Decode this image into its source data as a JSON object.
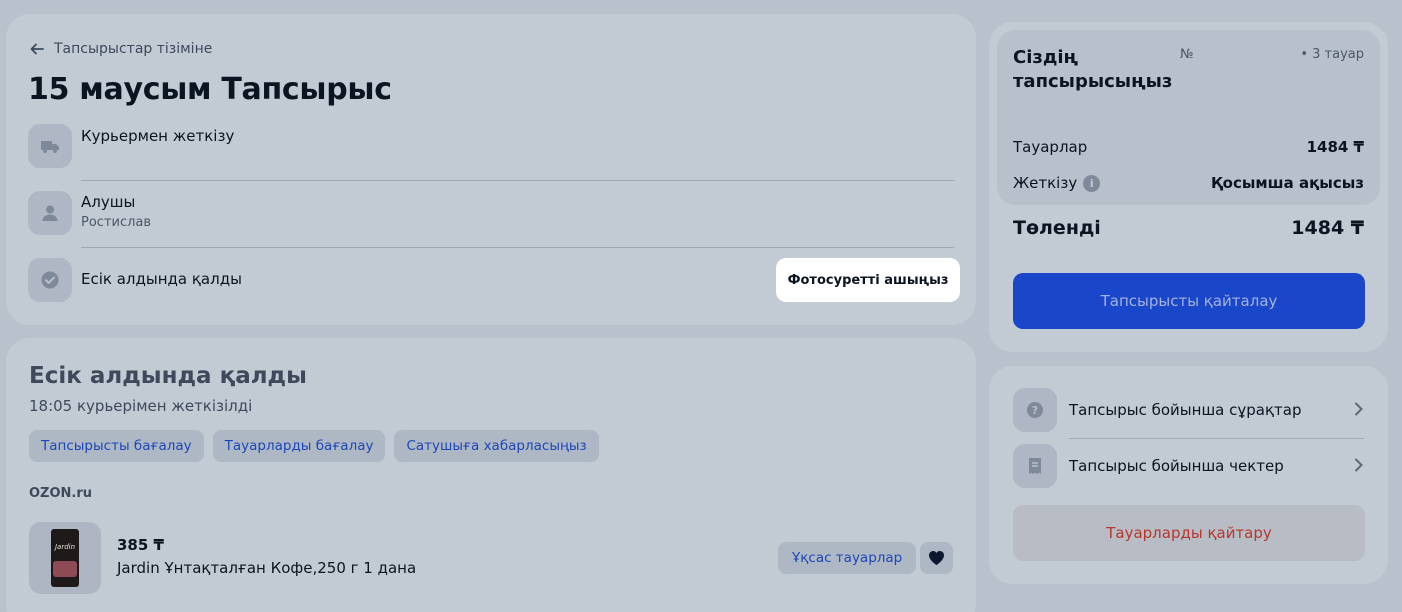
{
  "order": {
    "back_label": "Тапсырыстар тізіміне",
    "title": "15 маусым Тапсырыс",
    "delivery_method": "Курьермен жеткізу",
    "recipient_label": "Алушы",
    "recipient_name": "Ростислав",
    "status": "Есік алдында қалды",
    "photo_button": "Фотосуретті ашыңыз"
  },
  "delivery": {
    "title": "Есік алдында қалды",
    "subtitle": "18:05 курьерімен жеткізілді",
    "actions": [
      "Тапсырысты бағалау",
      "Тауарларды бағалау",
      "Сатушыға хабарласыңыз"
    ],
    "seller": "OZON.ru",
    "product": {
      "price": "385 ₸",
      "name": "Jardin Ұнтақталған Кофе,250 г 1 дана",
      "image_brand": "Jardin",
      "similar_button": "Ұқсас тауарлар",
      "fav_icon": "heart-icon"
    }
  },
  "summary": {
    "title": "Сіздің тапсырысыңыз",
    "number_label": "№",
    "count": "• 3 тауар",
    "goods_label": "Тауарлар",
    "goods_value": "1484 ₸",
    "delivery_label": "Жеткізу",
    "delivery_value": "Қосымша ақысыз",
    "paid_label": "Төленді",
    "paid_value": "1484 ₸",
    "repeat_button": "Тапсырысты қайталау"
  },
  "links": {
    "questions": "Тапсырыс бойынша сұрақтар",
    "receipts": "Тапсырыс бойынша чектер",
    "return_button": "Тауарларды қайтару"
  },
  "colors": {
    "accent_blue": "#1a46c9",
    "link_blue": "#1d46b8",
    "danger_red": "#b8362c"
  }
}
